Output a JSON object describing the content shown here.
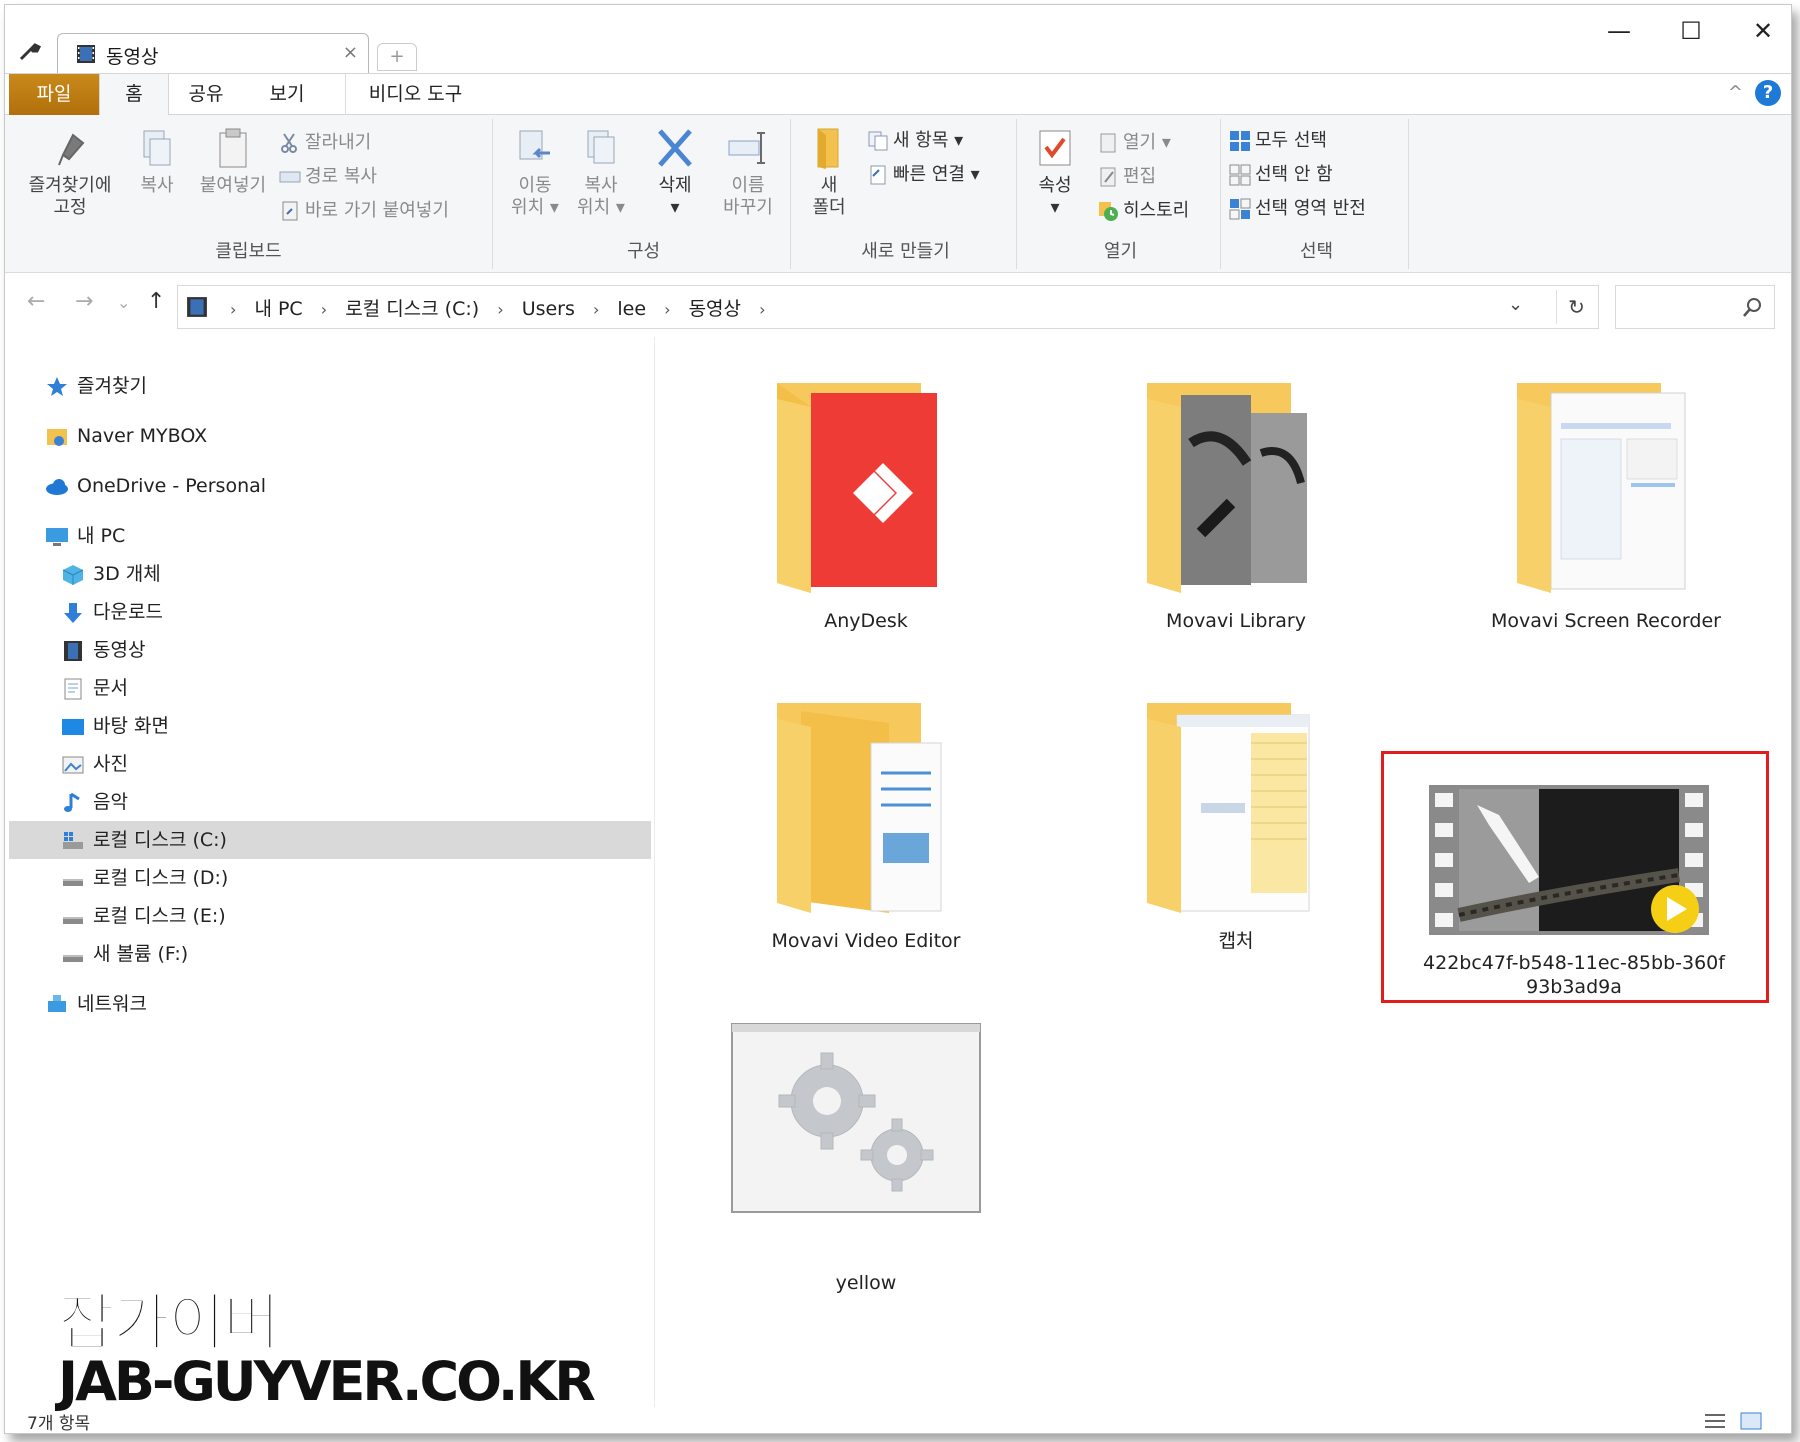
{
  "window": {
    "tab_title": "동영상",
    "tab_close": "×",
    "new_tab": "+",
    "minimize": "—",
    "maximize": "☐",
    "close": "✕"
  },
  "ribbon_tabs": {
    "file": "파일",
    "home": "홈",
    "share": "공유",
    "view": "보기",
    "video_tools": "비디오 도구",
    "collapse": "^",
    "help": "?"
  },
  "ribbon": {
    "clipboard": {
      "label": "클립보드",
      "pin_line1": "즐겨찾기에",
      "pin_line2": "고정",
      "copy": "복사",
      "paste": "붙여넣기",
      "cut": "잘라내기",
      "copy_path": "경로 복사",
      "paste_shortcut": "바로 가기 붙여넣기"
    },
    "organize": {
      "label": "구성",
      "move_line1": "이동",
      "move_line2": "위치 ▾",
      "copyto_line1": "복사",
      "copyto_line2": "위치 ▾",
      "delete_line1": "삭제",
      "delete_line2": "▾",
      "rename_line1": "이름",
      "rename_line2": "바꾸기"
    },
    "new": {
      "label": "새로 만들기",
      "new_folder_line1": "새",
      "new_folder_line2": "폴더",
      "new_item": "새 항목 ▾",
      "easy_access": "빠른 연결 ▾"
    },
    "open": {
      "label": "열기",
      "properties_line1": "속성",
      "properties_line2": "▾",
      "open": "열기 ▾",
      "edit": "편집",
      "history": "히스토리"
    },
    "select": {
      "label": "선택",
      "select_all": "모두 선택",
      "select_none": "선택 안 함",
      "invert": "선택 영역 반전"
    }
  },
  "navigation": {
    "back": "←",
    "forward": "→",
    "recent": "⌄",
    "up": "↑",
    "breadcrumb": [
      "내 PC",
      "로컬 디스크 (C:)",
      "Users",
      "lee",
      "동영상"
    ],
    "breadcrumb_sep": "›",
    "dropdown": "⌄",
    "refresh": "↻"
  },
  "sidebar": {
    "items": [
      {
        "label": "즐겨찾기"
      },
      {
        "label": "Naver MYBOX"
      },
      {
        "label": "OneDrive - Personal"
      },
      {
        "label": "내 PC"
      },
      {
        "label": "3D 개체"
      },
      {
        "label": "다운로드"
      },
      {
        "label": "동영상"
      },
      {
        "label": "문서"
      },
      {
        "label": "바탕 화면"
      },
      {
        "label": "사진"
      },
      {
        "label": "음악"
      },
      {
        "label": "로컬 디스크 (C:)"
      },
      {
        "label": "로컬 디스크 (D:)"
      },
      {
        "label": "로컬 디스크 (E:)"
      },
      {
        "label": "새 볼륨 (F:)"
      },
      {
        "label": "네트워크"
      }
    ],
    "selected": "로컬 디스크 (C:)"
  },
  "files": [
    {
      "name": "AnyDesk"
    },
    {
      "name": "Movavi Library"
    },
    {
      "name": "Movavi Screen Recorder"
    },
    {
      "name": "Movavi Video Editor"
    },
    {
      "name": "캡처"
    },
    {
      "name_line1": "422bc47f-b548-11ec-85bb-360f",
      "name_line2": "93b3ad9a"
    },
    {
      "name": "yellow"
    }
  ],
  "status": {
    "item_count": "7개 항목"
  },
  "watermark": {
    "korean": "잡가이버",
    "english": "JAB-GUYVER.CO.KR"
  },
  "colors": {
    "file_tab": "#b8860b",
    "highlight": "#e11d1d",
    "selected_nav": "#d9d9d9",
    "accent_blue": "#1e7ad6"
  }
}
